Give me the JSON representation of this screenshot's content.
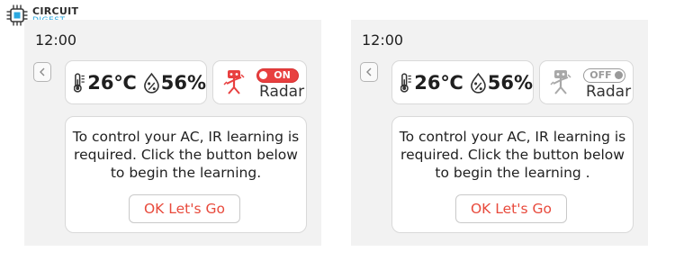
{
  "brand": {
    "line1": "CIRCUIT",
    "line2": "DIGEST"
  },
  "screens": [
    {
      "time": "12:00",
      "temperature": "26℃",
      "humidity": "56%",
      "radar": {
        "toggle_label": "ON",
        "label": "Radar",
        "state": "on"
      },
      "message": "To control your AC, IR learning is required. Click the button below to begin the learning.",
      "button_label": "OK Let's Go"
    },
    {
      "time": "12:00",
      "temperature": "26℃",
      "humidity": "56%",
      "radar": {
        "toggle_label": "OFF",
        "label": "Radar",
        "state": "off"
      },
      "message": "To control your AC, IR learning is required. Click the button below to begin the learning .",
      "button_label": "OK Let's Go"
    }
  ],
  "colors": {
    "accent": "#e84040",
    "inactive": "#9a9a9a",
    "panel": "#f2f2f2"
  },
  "icons": [
    "brand-chip-icon",
    "chevron-left-icon",
    "thermometer-icon",
    "humidity-drop-icon",
    "robot-radar-icon"
  ]
}
